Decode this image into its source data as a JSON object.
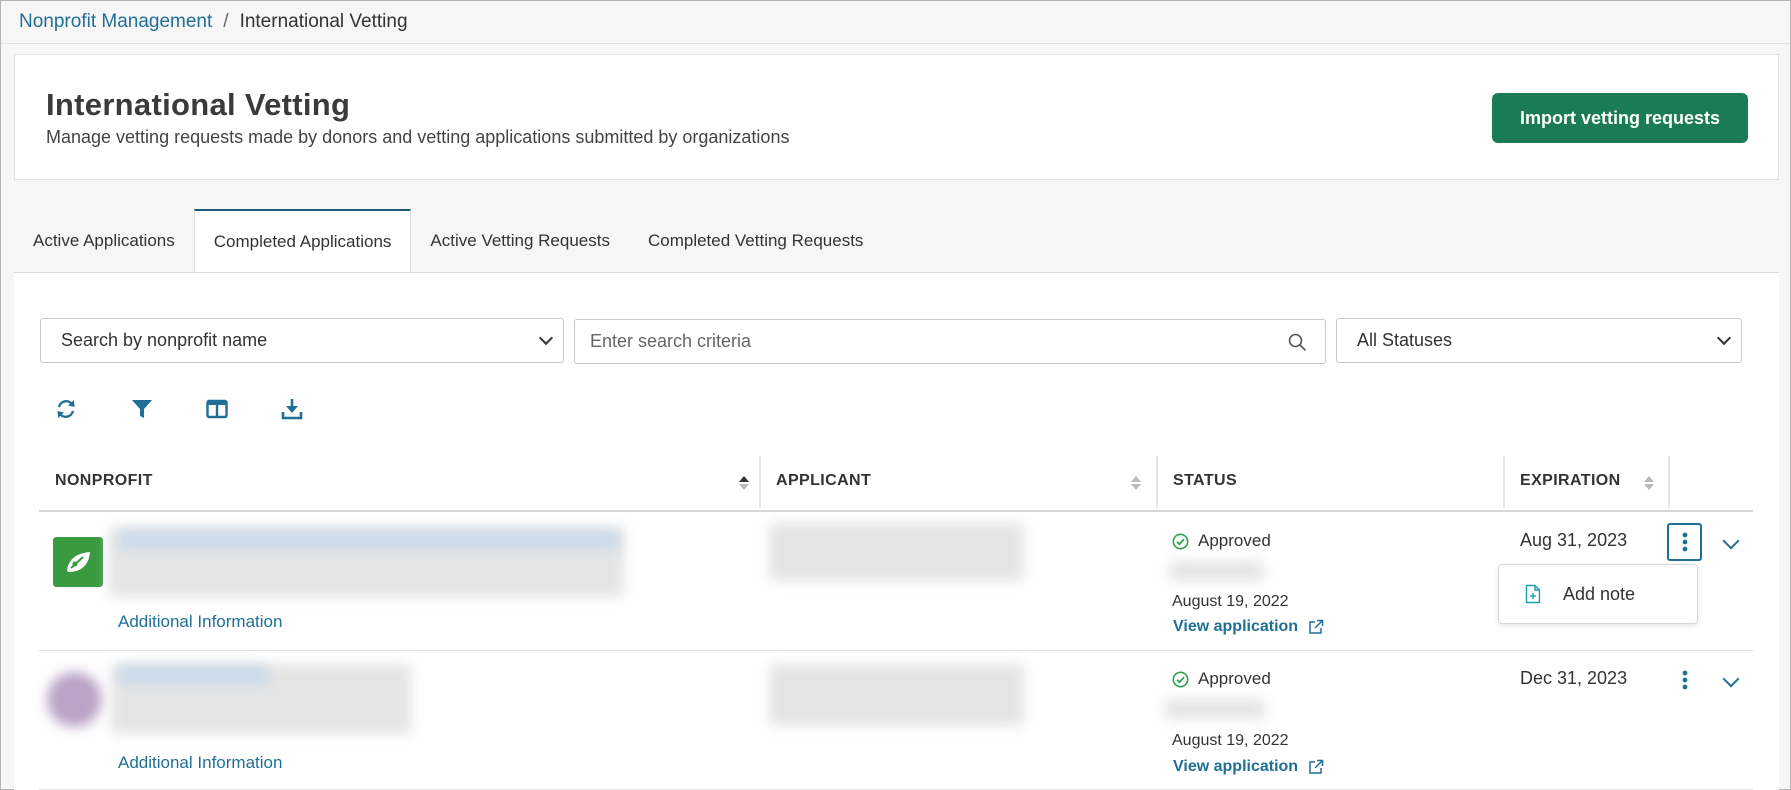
{
  "breadcrumb": {
    "parent": "Nonprofit Management",
    "separator": "/",
    "current": "International Vetting"
  },
  "header": {
    "title": "International Vetting",
    "subtitle": "Manage vetting requests made by donors and vetting applications submitted by organizations",
    "import_button": "Import vetting requests"
  },
  "tabs": [
    {
      "label": "Active Applications",
      "active": false
    },
    {
      "label": "Completed Applications",
      "active": true
    },
    {
      "label": "Active Vetting Requests",
      "active": false
    },
    {
      "label": "Completed Vetting Requests",
      "active": false
    }
  ],
  "filters": {
    "nonprofit_select": "Search by nonprofit name",
    "search_placeholder": "Enter search criteria",
    "status_select": "All Statuses"
  },
  "toolbar": {
    "icons": [
      "refresh-icon",
      "filter-icon",
      "columns-icon",
      "download-icon"
    ]
  },
  "table": {
    "columns": [
      "NONPROFIT",
      "APPLICANT",
      "STATUS",
      "EXPIRATION"
    ],
    "rows": [
      {
        "additional_info": "Additional Information",
        "status": "Approved",
        "status_date": "August 19, 2022",
        "view_link": "View application",
        "expiration": "Aug 31, 2023"
      },
      {
        "additional_info": "Additional Information",
        "status": "Approved",
        "status_date": "August 19, 2022",
        "view_link": "View application",
        "expiration": "Dec 31, 2023"
      }
    ]
  },
  "row_menu": {
    "add_note": "Add note"
  },
  "colors": {
    "primary_green": "#1c7b57",
    "link_blue": "#1f6f96",
    "success_green": "#2e9e4f"
  }
}
